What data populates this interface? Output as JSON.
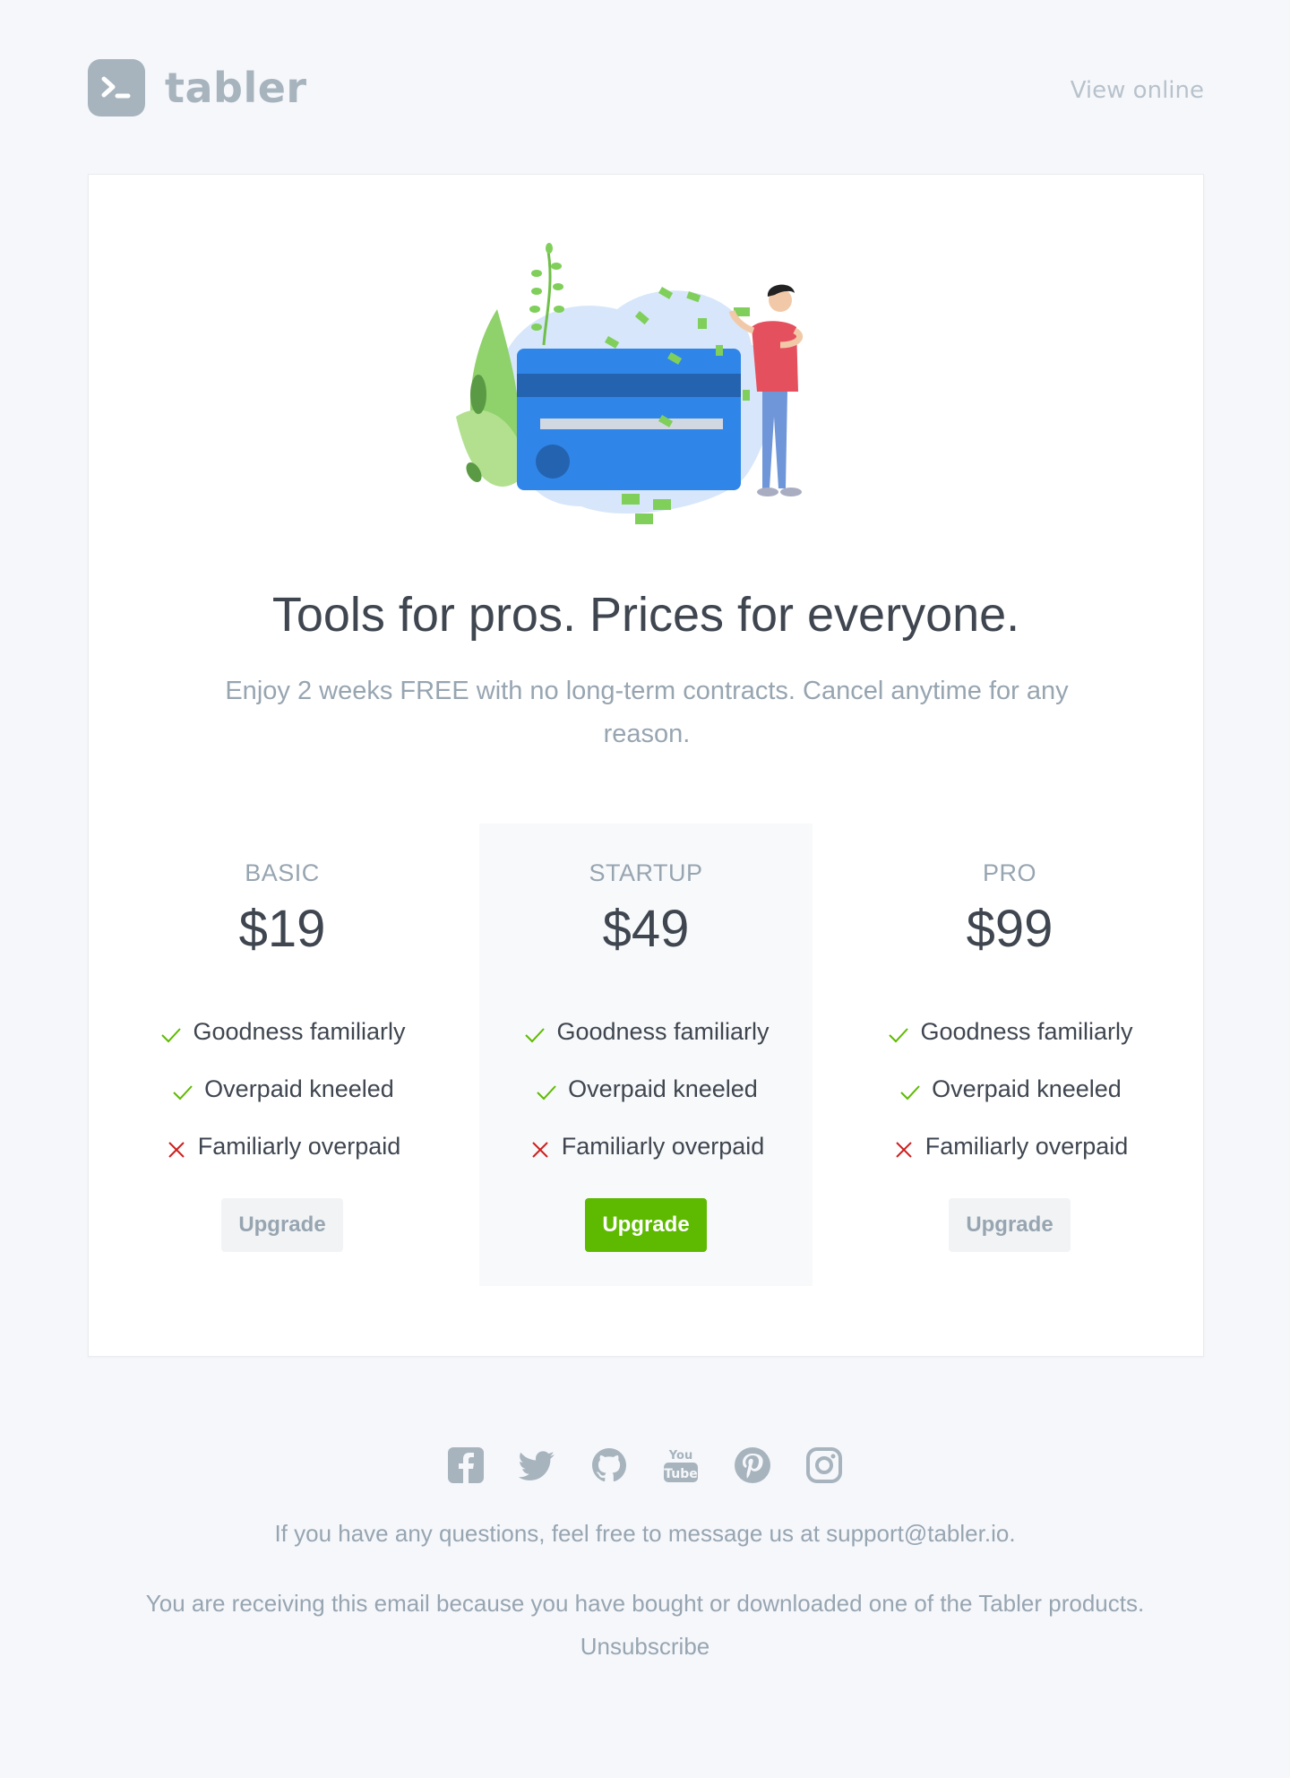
{
  "brand": {
    "name": "tabler"
  },
  "header": {
    "view_online": "View online"
  },
  "hero": {
    "title": "Tools for pros. Prices for everyone.",
    "subtitle": "Enjoy 2 weeks FREE with no long-term contracts. Cancel anytime for any reason."
  },
  "plans": [
    {
      "name": "BASIC",
      "price": "$19",
      "featured": false,
      "button": "Upgrade",
      "features": [
        {
          "label": "Goodness familiarly",
          "included": true
        },
        {
          "label": "Overpaid kneeled",
          "included": true
        },
        {
          "label": "Familiarly overpaid",
          "included": false
        }
      ]
    },
    {
      "name": "STARTUP",
      "price": "$49",
      "featured": true,
      "button": "Upgrade",
      "features": [
        {
          "label": "Goodness familiarly",
          "included": true
        },
        {
          "label": "Overpaid kneeled",
          "included": true
        },
        {
          "label": "Familiarly overpaid",
          "included": false
        }
      ]
    },
    {
      "name": "PRO",
      "price": "$99",
      "featured": false,
      "button": "Upgrade",
      "features": [
        {
          "label": "Goodness familiarly",
          "included": true
        },
        {
          "label": "Overpaid kneeled",
          "included": true
        },
        {
          "label": "Familiarly overpaid",
          "included": false
        }
      ]
    }
  ],
  "social": [
    "facebook-icon",
    "twitter-icon",
    "github-icon",
    "youtube-icon",
    "pinterest-icon",
    "instagram-icon"
  ],
  "footer": {
    "questions": "If you have any questions, feel free to message us at support@tabler.io.",
    "receiving": "You are receiving this email because you have bought or downloaded one of the Tabler products.",
    "unsubscribe": "Unsubscribe"
  },
  "colors": {
    "background": "#f5f7fb",
    "primary": "#5eba00",
    "muted": "#97a5b1",
    "check": "#5eba00",
    "cross": "#cd201f"
  }
}
